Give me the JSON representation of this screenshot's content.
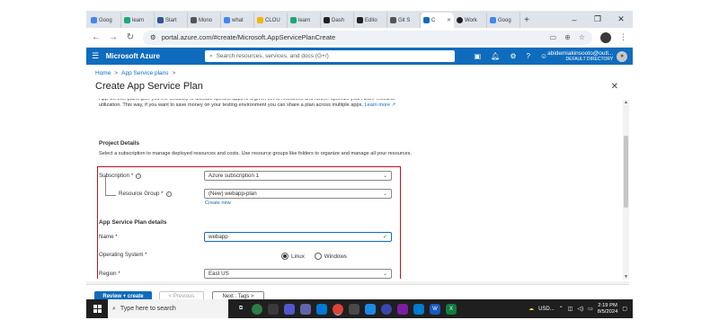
{
  "browser": {
    "tabs": [
      {
        "label": "Goog",
        "color": "#4285f4"
      },
      {
        "label": "learn",
        "color": "#19a974"
      },
      {
        "label": "Start",
        "color": "#2b5797"
      },
      {
        "label": "Mono",
        "color": "#555555"
      },
      {
        "label": "what",
        "color": "#4285f4"
      },
      {
        "label": "CLOU",
        "color": "#f4b400"
      },
      {
        "label": "learn",
        "color": "#19a974"
      },
      {
        "label": "Dash",
        "color": "#222222"
      },
      {
        "label": "Edito",
        "color": "#222222"
      },
      {
        "label": "Git S",
        "color": "#555555"
      },
      {
        "label": "C",
        "color": "#0f6cbd",
        "active": true
      },
      {
        "label": "Work",
        "color": "#222222"
      },
      {
        "label": "Goog",
        "color": "#4285f4"
      }
    ],
    "url": "portal.azure.com/#create/Microsoft.AppServicePlanCreate"
  },
  "azure": {
    "brand": "Microsoft Azure",
    "search_placeholder": "Search resources, services, and docs (G+/)",
    "account_name": "abidemiakinsooto@outl...",
    "account_directory": "DEFAULT DIRECTORY"
  },
  "breadcrumb": {
    "home": "Home",
    "sep1": ">",
    "parent": "App Service plans",
    "sep2": ">"
  },
  "page": {
    "title": "Create App Service Plan",
    "intro": "App Service plans give you the flexibility to allocate specific apps to a given set of resources and further optimize your Azure resource utilization. This way, if you want to save money on your testing environment you can share a plan across multiple apps.",
    "learn_more": "Learn more",
    "project_details_title": "Project Details",
    "project_details_desc": "Select a subscription to manage deployed resources and costs. Use resource groups like folders to organize and manage all your resources.",
    "subscription_label": "Subscription *",
    "subscription_value": "Azure subscription 1",
    "resource_group_label": "Resource Group *",
    "resource_group_value": "(New) webapp-plan",
    "create_new": "Create new",
    "plan_details_title": "App Service Plan details",
    "name_label": "Name *",
    "name_value": "webapp",
    "os_label": "Operating System *",
    "os_linux": "Linux",
    "os_windows": "Windows",
    "region_label": "Region *",
    "region_value": "East US"
  },
  "footer": {
    "review_create": "Review + create",
    "previous": "< Previous",
    "next": "Next : Tags >"
  },
  "taskbar": {
    "search_placeholder": "Type here to search",
    "weather": "USD...",
    "time": "2:19 PM",
    "date": "8/5/2024"
  }
}
